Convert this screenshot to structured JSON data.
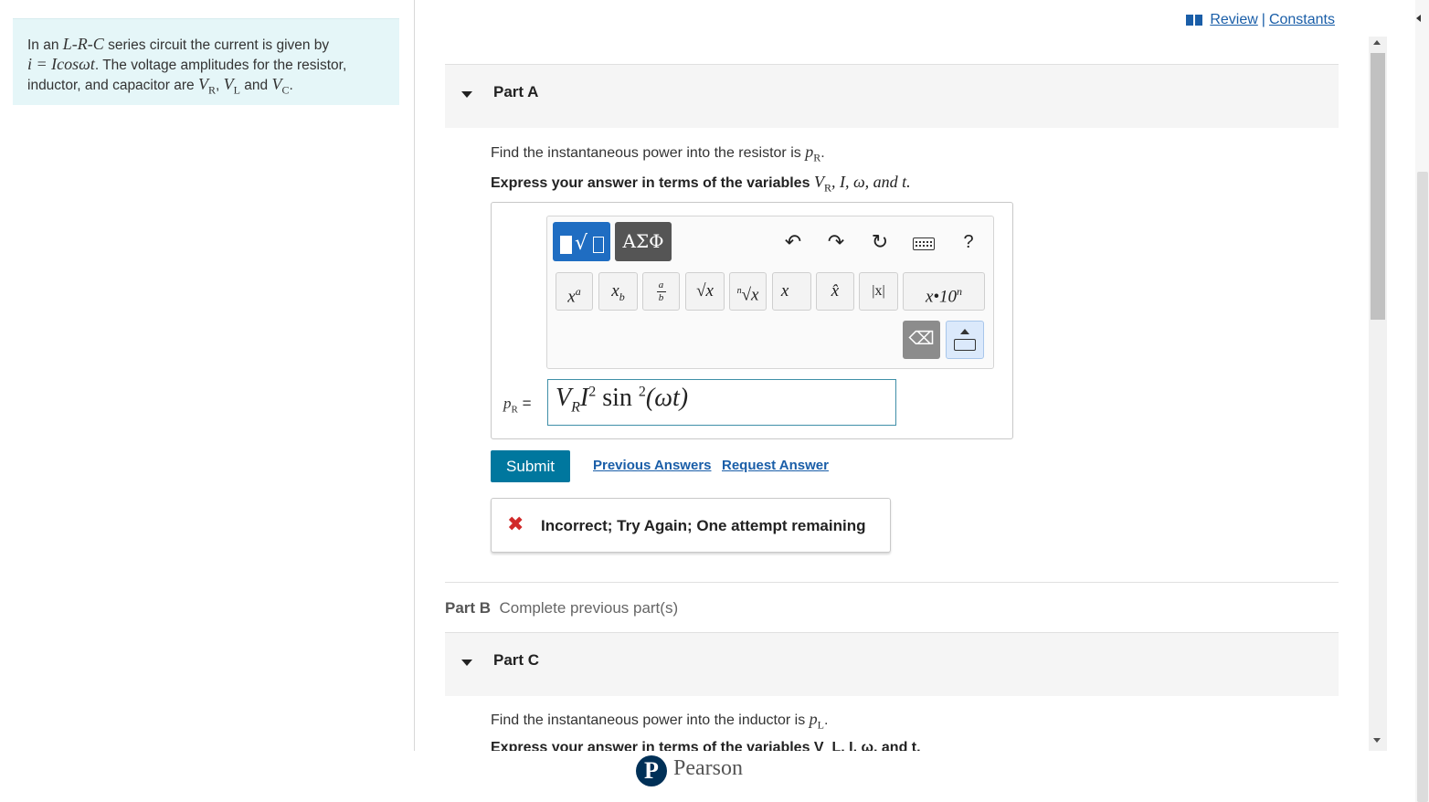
{
  "problem": {
    "intro": "In an",
    "circuit": "L-R-C",
    "text1": "series circuit the current is given by",
    "current_eq": "i = Icosωt",
    "text2": ". The voltage amplitudes for the resistor, inductor, and capacitor are",
    "vr": "V",
    "vr_sub": "R",
    "vl": "V",
    "vl_sub": "L",
    "and": "and",
    "vc": "V",
    "vc_sub": "C",
    "period": "."
  },
  "links": {
    "review": "Review",
    "separator": "|",
    "constants": "Constants"
  },
  "partA": {
    "title": "Part A",
    "prompt": "Find the instantaneous power into the resistor is",
    "prompt_var": "p",
    "prompt_sub": "R",
    "instruction": "Express your answer in terms of the variables",
    "instruction_vars": "V",
    "instruction_vars_sub": "R",
    "instruction_rest": ", I, ω, and t.",
    "toolbar": {
      "greek": "ΑΣΦ",
      "help": "?",
      "buttons": [
        "xᵃ",
        "x_b",
        "a/b",
        "√x",
        "ⁿ√x",
        "x⃗",
        "x̂",
        "|x|",
        "x•10ⁿ"
      ]
    },
    "answer_label": "p",
    "answer_label_sub": "R",
    "answer_eq": "=",
    "answer": {
      "v": "V",
      "v_sub": "R",
      "i": "I",
      "i_sup": "2",
      "sin": " sin ",
      "sin_sup": "2",
      "arg": "(ωt)"
    },
    "submit": "Submit",
    "previous_answers": "Previous Answers",
    "request_answer": "Request Answer",
    "feedback_icon": "✖",
    "feedback": "Incorrect; Try Again; One attempt remaining"
  },
  "partB": {
    "title": "Part B",
    "status": "Complete previous part(s)"
  },
  "partC": {
    "title": "Part C",
    "prompt": "Find the instantaneous power into the inductor is",
    "prompt_var": "p",
    "prompt_sub": "L",
    "instruction": "Express your answer in terms of the variables V_L, I, ω, and t."
  },
  "footer": {
    "logo_letter": "P",
    "brand": "Pearson"
  },
  "colors": {
    "accent": "#00779e",
    "link": "#1a5ea8",
    "error": "#d12a2a",
    "problem_bg": "#e5f6f8"
  }
}
